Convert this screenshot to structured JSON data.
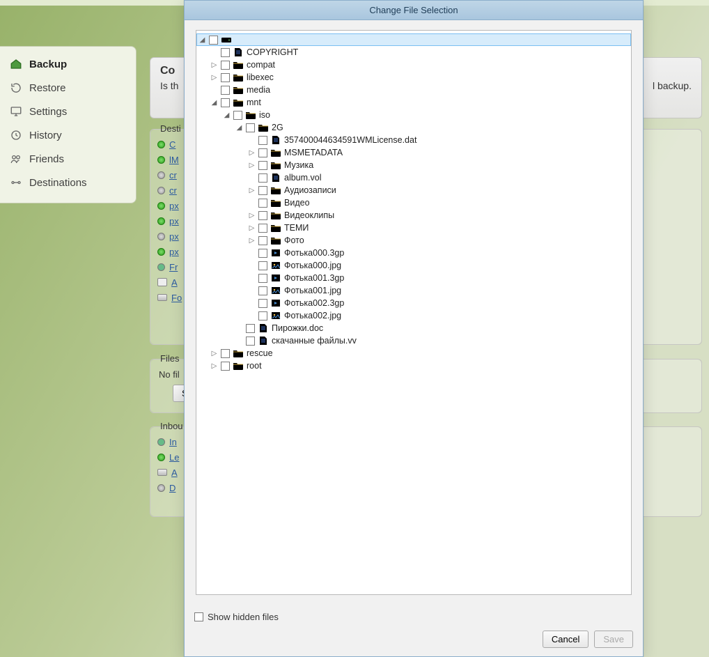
{
  "app": {
    "sidebar": {
      "items": [
        {
          "label": "Backup",
          "icon": "home"
        },
        {
          "label": "Restore",
          "icon": "restore"
        },
        {
          "label": "Settings",
          "icon": "monitor"
        },
        {
          "label": "History",
          "icon": "clock"
        },
        {
          "label": "Friends",
          "icon": "friends"
        },
        {
          "label": "Destinations",
          "icon": "destinations"
        }
      ]
    },
    "card": {
      "title": "Co",
      "subtitle": "Is th",
      "right_text": "l backup."
    },
    "groups": {
      "dest": {
        "legend": "Desti",
        "items": [
          {
            "status": "green",
            "link": "C"
          },
          {
            "status": "green",
            "link": "lM"
          },
          {
            "status": "gray",
            "link": "cr"
          },
          {
            "status": "gray",
            "link": "cr"
          },
          {
            "status": "green",
            "link": "px"
          },
          {
            "status": "green",
            "link": "px"
          },
          {
            "status": "gray",
            "link": "px"
          },
          {
            "status": "green",
            "link": "px"
          },
          {
            "status": "friend",
            "link": "Fr"
          },
          {
            "status": "pc",
            "link": "A"
          },
          {
            "status": "disk",
            "link": "Fo"
          }
        ]
      },
      "files": {
        "legend": "Files",
        "empty": "No fil",
        "select_btn": "S"
      },
      "inbound": {
        "legend": "Inbou",
        "items": [
          {
            "icon": "friend",
            "link": "In"
          },
          {
            "icon": "green",
            "link": "Le"
          },
          {
            "icon": "disk",
            "link": "A"
          },
          {
            "icon": "gray",
            "link": "D"
          }
        ]
      }
    }
  },
  "dialog": {
    "title": "Change File Selection",
    "show_hidden_label": "Show hidden files",
    "buttons": {
      "cancel": "Cancel",
      "save": "Save"
    },
    "tree": [
      {
        "type": "drive",
        "label": "",
        "expanded": true,
        "selected": true,
        "children": [
          {
            "type": "file-doc",
            "label": "COPYRIGHT"
          },
          {
            "type": "folder",
            "label": "compat",
            "expandable": true
          },
          {
            "type": "folder",
            "label": "libexec",
            "expandable": true
          },
          {
            "type": "folder",
            "label": "media"
          },
          {
            "type": "folder",
            "label": "mnt",
            "expanded": true,
            "children": [
              {
                "type": "folder",
                "label": "iso",
                "expanded": true,
                "children": [
                  {
                    "type": "folder",
                    "label": "2G",
                    "expanded": true,
                    "children": [
                      {
                        "type": "file-doc",
                        "label": "357400044634591WMLicense.dat"
                      },
                      {
                        "type": "folder",
                        "label": "MSMETADATA",
                        "expandable": true
                      },
                      {
                        "type": "folder",
                        "label": "Музика",
                        "expandable": true
                      },
                      {
                        "type": "file-doc",
                        "label": "album.vol"
                      },
                      {
                        "type": "folder",
                        "label": "Аудиозаписи",
                        "expandable": true
                      },
                      {
                        "type": "folder",
                        "label": "Видео"
                      },
                      {
                        "type": "folder",
                        "label": "Видеоклипы",
                        "expandable": true
                      },
                      {
                        "type": "folder",
                        "label": "ТЕМИ",
                        "expandable": true
                      },
                      {
                        "type": "folder",
                        "label": "Фото",
                        "expandable": true
                      },
                      {
                        "type": "file-vid",
                        "label": "Фотька000.3gp"
                      },
                      {
                        "type": "file-img",
                        "label": "Фотька000.jpg"
                      },
                      {
                        "type": "file-vid",
                        "label": "Фотька001.3gp"
                      },
                      {
                        "type": "file-img",
                        "label": "Фотька001.jpg"
                      },
                      {
                        "type": "file-vid",
                        "label": "Фотька002.3gp"
                      },
                      {
                        "type": "file-img",
                        "label": "Фотька002.jpg"
                      }
                    ]
                  },
                  {
                    "type": "file-doc",
                    "label": "Пирожки.doc"
                  },
                  {
                    "type": "file-doc",
                    "label": "скачанные файлы.vv"
                  }
                ]
              }
            ]
          },
          {
            "type": "folder",
            "label": "rescue",
            "expandable": true
          },
          {
            "type": "folder",
            "label": "root",
            "expandable": true
          }
        ]
      }
    ]
  }
}
